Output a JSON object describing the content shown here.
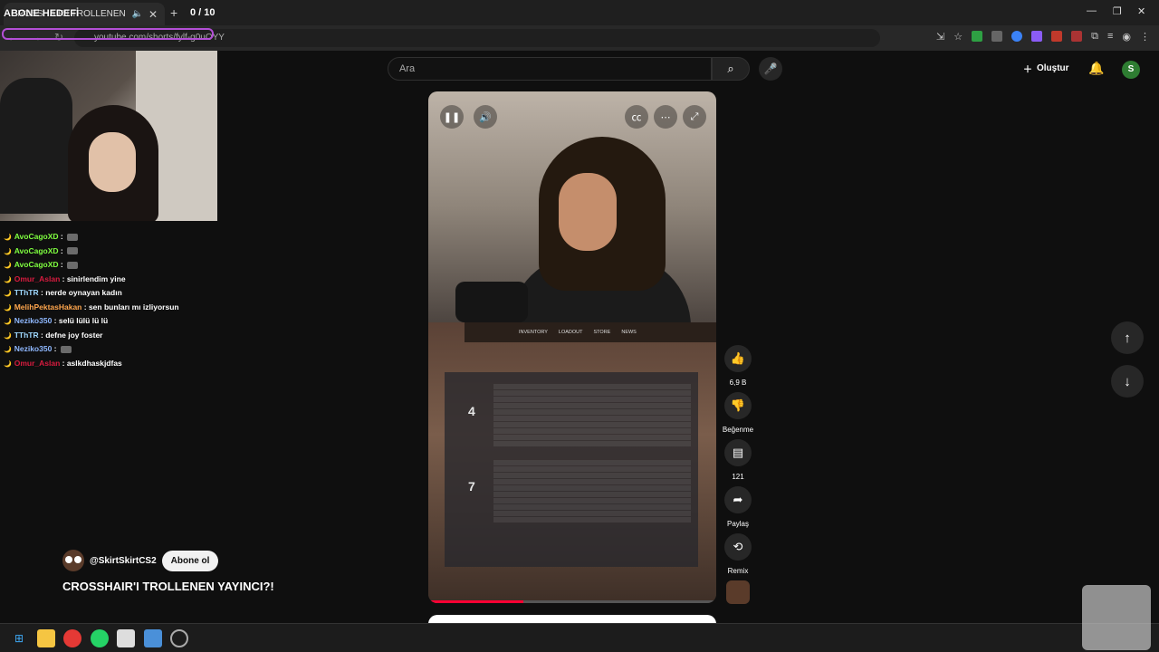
{
  "browser": {
    "tab_title": "CROSSHAIR'I TROLLENEN Y",
    "counter": "0 / 10",
    "url": "youtube.com/shorts/fylf-g0uOYY"
  },
  "overlay": {
    "title": "ABONE HEDEFİ"
  },
  "chat": [
    {
      "user": "AvoCagoXD",
      "color": "#7fff3f",
      "msg": "",
      "emote": true
    },
    {
      "user": "AvoCagoXD",
      "color": "#7fff3f",
      "msg": "",
      "emote": true
    },
    {
      "user": "AvoCagoXD",
      "color": "#7fff3f",
      "msg": "",
      "emote": true
    },
    {
      "user": "Omur_Aslan",
      "color": "#d81b3f",
      "msg": "sinirlendim yine",
      "emote": false
    },
    {
      "user": "TThTR",
      "color": "#9fd8ff",
      "msg": "nerde oynayan kadın",
      "emote": false
    },
    {
      "user": "MelihPektasHakan",
      "color": "#ffa64d",
      "msg": "sen bunları mı izliyorsun",
      "emote": false
    },
    {
      "user": "Neziko350",
      "color": "#8fb8ff",
      "msg": "selü lülü lü lü",
      "emote": false
    },
    {
      "user": "TThTR",
      "color": "#9fd8ff",
      "msg": "defne joy foster",
      "emote": false
    },
    {
      "user": "Neziko350",
      "color": "#8fb8ff",
      "msg": "",
      "emote": true
    },
    {
      "user": "Omur_Aslan",
      "color": "#d81b3f",
      "msg": "aslkdhaskjdfas",
      "emote": false
    }
  ],
  "youtube": {
    "search_placeholder": "Ara",
    "create_label": "Oluştur",
    "user_initial": "S"
  },
  "short": {
    "channel": "@SkirtSkirtCS2",
    "subscribe_label": "Abone ol",
    "title": "CROSSHAIR'I TROLLENEN YAYINCI?!",
    "progress": 0.33,
    "game_menu": [
      "INVENTORY",
      "LOADOUT",
      "STORE",
      "NEWS"
    ],
    "team_scores": [
      "4",
      "7"
    ]
  },
  "actions": {
    "like_count": "6,9 B",
    "dislike_label": "Beğenme",
    "comment_count": "121",
    "share_label": "Paylaş",
    "remix_label": "Remix"
  },
  "colors": {
    "accent": "#ff0033",
    "overlay_border": "#b34fd6"
  }
}
